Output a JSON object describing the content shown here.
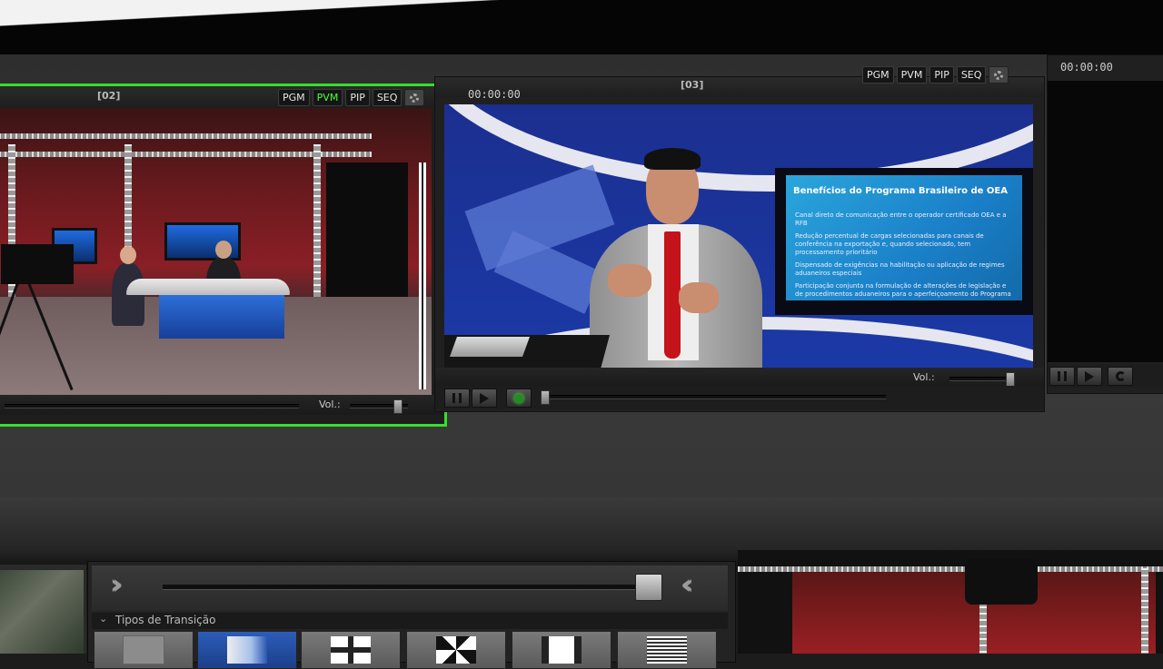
{
  "monitors": [
    {
      "id": "[02]",
      "tabs": [
        "PGM",
        "PVM",
        "PIP",
        "SEQ"
      ],
      "active_tab": "PVM",
      "volume_label": "Vol.:",
      "selected": true,
      "scene": "news-studio",
      "volume_level": 0.8
    },
    {
      "id": "[03]",
      "time": "00:00:00",
      "tabs": [
        "PGM",
        "PVM",
        "PIP",
        "SEQ"
      ],
      "volume_label": "Vol.:",
      "scene": "presenter",
      "volume_level": 0.95,
      "slide": {
        "title": "Benefícios do Programa Brasileiro de OEA",
        "bullets": [
          "Canal direto de comunicação entre o operador certificado OEA e a RFB",
          "Redução percentual de cargas selecionadas para canais de conferência na exportação e, quando selecionado, tem processamento prioritário",
          "Dispensado de exigências na habilitação ou aplicação de regimes aduaneiros especiais",
          "Participação conjunta na formulação de alterações de legislação e de procedimentos aduaneiros para o aperfeiçoamento do Programa"
        ]
      }
    },
    {
      "time": "00:00:00",
      "scene": "black"
    }
  ],
  "transitions": {
    "header": "Tipos de Transição",
    "fader_level": 0.92,
    "types": [
      "none",
      "wipe-gradient",
      "cross",
      "pinwheel",
      "bars",
      "lines"
    ],
    "selected_index": 1
  },
  "colors": {
    "selected_border": "#35e02a",
    "active_tab_text": "#4cff3a",
    "selected_transition": "#2c5db8"
  }
}
